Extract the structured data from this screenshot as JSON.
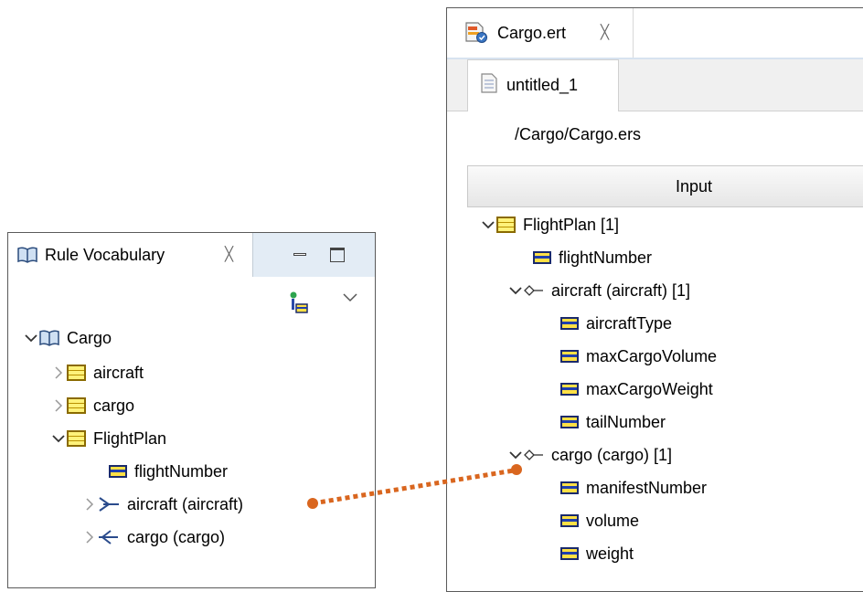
{
  "vocab": {
    "tab_title": "Rule Vocabulary",
    "close_glyph": "╳",
    "tree": [
      {
        "label": "Cargo",
        "icon": "vocabulary-book-icon",
        "expander": "expanded"
      },
      {
        "label": "aircraft",
        "icon": "entity-icon",
        "expander": "collapsed"
      },
      {
        "label": "cargo",
        "icon": "entity-icon",
        "expander": "collapsed"
      },
      {
        "label": "FlightPlan",
        "icon": "entity-icon",
        "expander": "expanded"
      },
      {
        "label": "flightNumber",
        "icon": "attribute-icon",
        "expander": "none"
      },
      {
        "label": "aircraft (aircraft)",
        "icon": "association-many-to-one-icon",
        "expander": "collapsed"
      },
      {
        "label": "cargo (cargo)",
        "icon": "association-one-to-many-icon",
        "expander": "collapsed"
      }
    ]
  },
  "editor": {
    "tab_title": "Cargo.ert",
    "close_glyph": "╳",
    "subtab_title": "untitled_1",
    "vocab_path": "/Cargo/Cargo.ers",
    "input_label": "Input",
    "tree": [
      {
        "label": "FlightPlan [1]",
        "icon": "entity-icon",
        "expander": "expanded"
      },
      {
        "label": "flightNumber",
        "icon": "attribute-icon",
        "expander": "none"
      },
      {
        "label": "aircraft (aircraft) [1]",
        "icon": "association-icon",
        "expander": "expanded"
      },
      {
        "label": "aircraftType",
        "icon": "attribute-icon",
        "expander": "none"
      },
      {
        "label": "maxCargoVolume",
        "icon": "attribute-icon",
        "expander": "none"
      },
      {
        "label": "maxCargoWeight",
        "icon": "attribute-icon",
        "expander": "none"
      },
      {
        "label": "tailNumber",
        "icon": "attribute-icon",
        "expander": "none"
      },
      {
        "label": "cargo (cargo) [1]",
        "icon": "association-icon",
        "expander": "expanded"
      },
      {
        "label": "manifestNumber",
        "icon": "attribute-icon",
        "expander": "none"
      },
      {
        "label": "volume",
        "icon": "attribute-icon",
        "expander": "none"
      },
      {
        "label": "weight",
        "icon": "attribute-icon",
        "expander": "none"
      }
    ]
  },
  "colors": {
    "connector": "#d9661f",
    "tab_bar": "#e3ecf5",
    "attribute_yellow": "#ffe045",
    "attribute_blue": "#1f3fae"
  }
}
